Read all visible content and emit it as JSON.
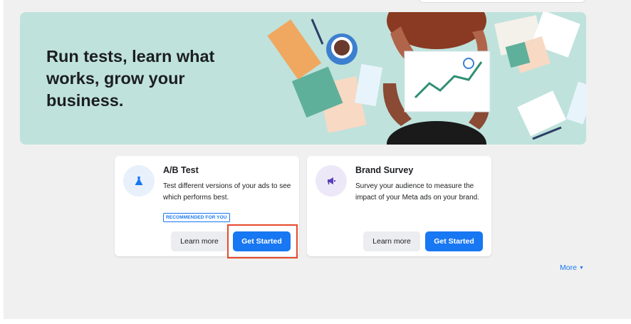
{
  "banner": {
    "title": "Run tests, learn what works, grow your business."
  },
  "cards": [
    {
      "icon": "flask-icon",
      "title": "A/B Test",
      "description": "Test different versions of your ads to see which performs best.",
      "badge": "RECOMMENDED FOR YOU",
      "learn_more": "Learn more",
      "get_started": "Get Started"
    },
    {
      "icon": "megaphone-icon",
      "title": "Brand Survey",
      "description": "Survey your audience to measure the impact of your Meta ads on your brand.",
      "learn_more": "Learn more",
      "get_started": "Get Started"
    }
  ],
  "more": {
    "label": "More",
    "icon": "caret-down-icon"
  },
  "colors": {
    "primary": "#1877f2",
    "banner_bg": "#bfe2dc",
    "highlight": "#e8492b"
  }
}
